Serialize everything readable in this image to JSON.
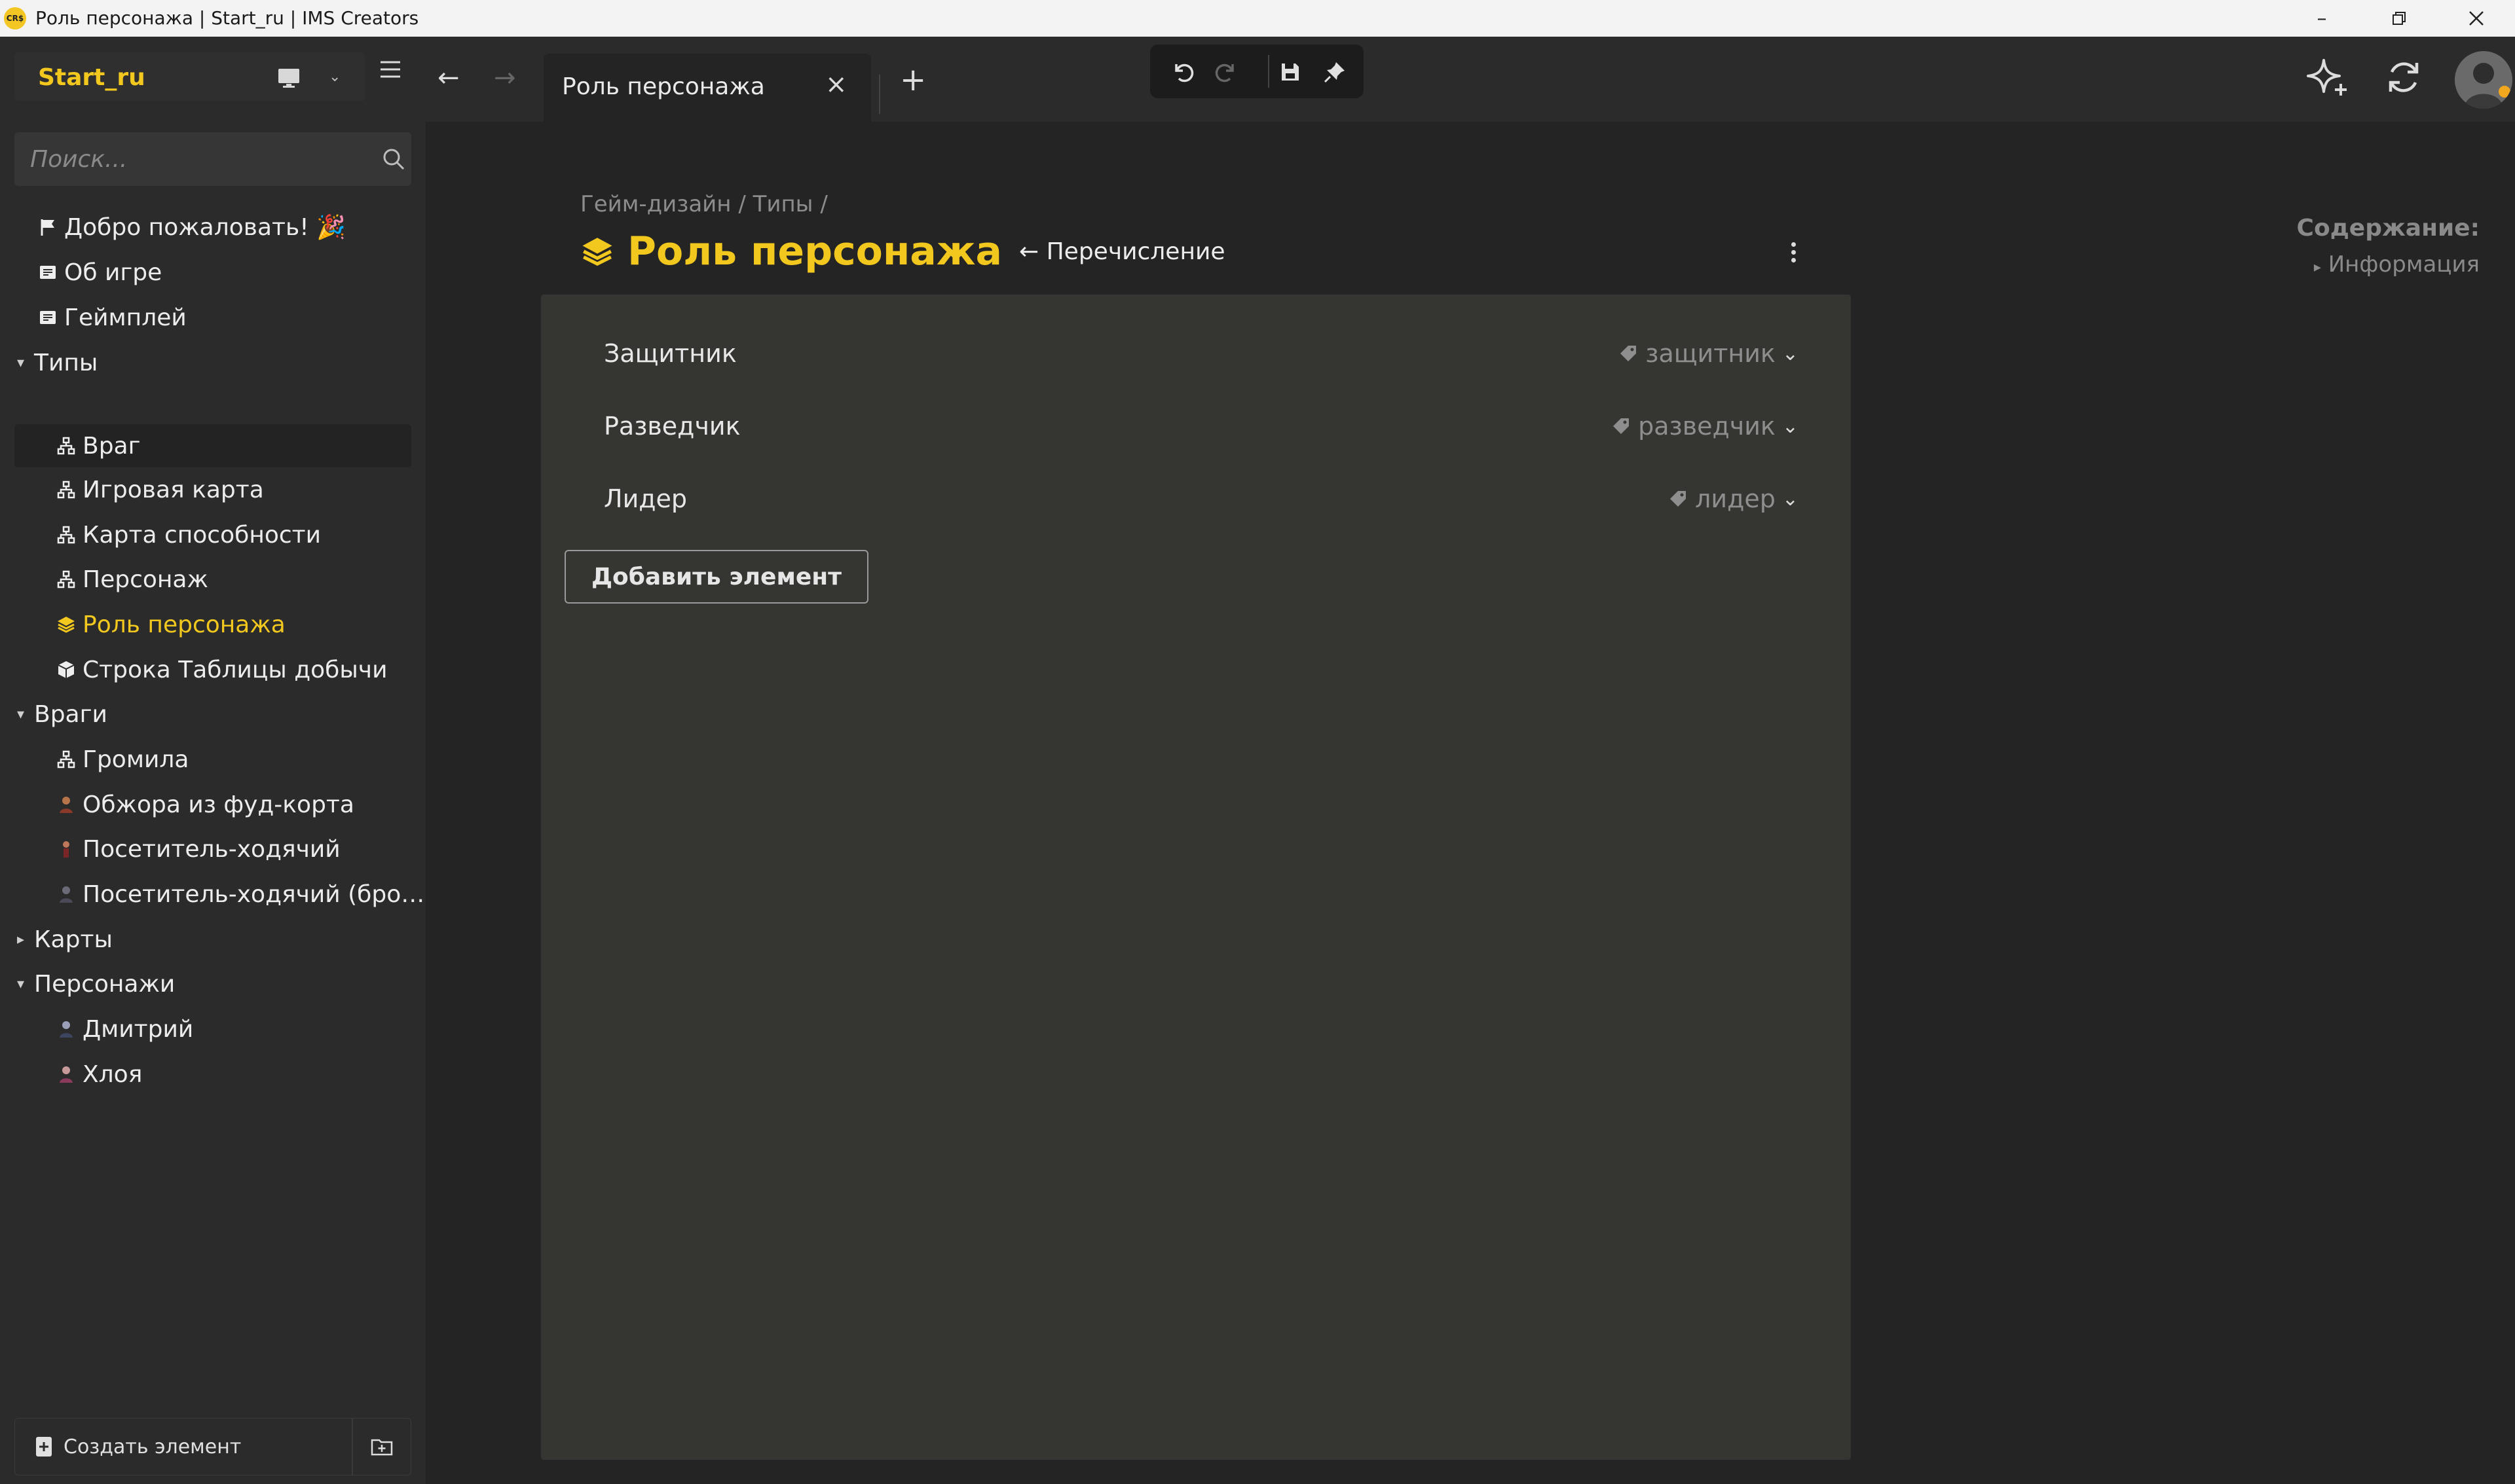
{
  "window": {
    "title": "Роль персонажа | Start_ru | IMS Creators",
    "logo_text": "CR$"
  },
  "sidebar": {
    "project_name": "Start_ru",
    "search_placeholder": "Поиск...",
    "tree": [
      {
        "label": "Добро пожаловать! 🎉",
        "icon": "flag-icon"
      },
      {
        "label": "Об игре",
        "icon": "document-icon"
      },
      {
        "label": "Геймплей",
        "icon": "document-icon"
      },
      {
        "label": "Типы",
        "icon": "caret-down-icon"
      },
      {
        "label": "Враг",
        "icon": "type-structure-icon"
      },
      {
        "label": "Игровая карта",
        "icon": "type-structure-icon"
      },
      {
        "label": "Карта способности",
        "icon": "type-structure-icon"
      },
      {
        "label": "Персонаж",
        "icon": "type-structure-icon"
      },
      {
        "label": "Роль персонажа",
        "icon": "enum-layers-icon"
      },
      {
        "label": "Строка Таблицы добычи",
        "icon": "cube-icon"
      },
      {
        "label": "Враги",
        "icon": "caret-down-icon"
      },
      {
        "label": "Громила",
        "icon": "type-structure-icon"
      },
      {
        "label": "Обжора из фуд-корта",
        "icon": "character-avatar-icon"
      },
      {
        "label": "Посетитель-ходячий",
        "icon": "character-avatar-icon"
      },
      {
        "label": "Посетитель-ходячий (бро…",
        "icon": "character-avatar-icon"
      },
      {
        "label": "Карты",
        "icon": "caret-right-icon"
      },
      {
        "label": "Персонажи",
        "icon": "caret-down-icon"
      },
      {
        "label": "Дмитрий",
        "icon": "character-avatar-icon"
      },
      {
        "label": "Хлоя",
        "icon": "character-avatar-icon"
      }
    ],
    "create_label": "Создать элемент"
  },
  "tabs": {
    "active_label": "Роль персонажа"
  },
  "page": {
    "breadcrumb": "Гейм-дизайн / Типы /",
    "title": "Роль персонажа",
    "type_link": "← Перечисление",
    "entries": [
      {
        "name": "Защитник",
        "value": "защитник"
      },
      {
        "name": "Разведчик",
        "value": "разведчик"
      },
      {
        "name": "Лидер",
        "value": "лидер"
      }
    ],
    "add_button": "Добавить элемент"
  },
  "toc": {
    "title": "Содержание:",
    "items": [
      "Информация"
    ]
  },
  "colors": {
    "accent": "#f2c81e",
    "background": "#242424",
    "sidebar": "#2b2b2b",
    "panel": "#353631"
  }
}
